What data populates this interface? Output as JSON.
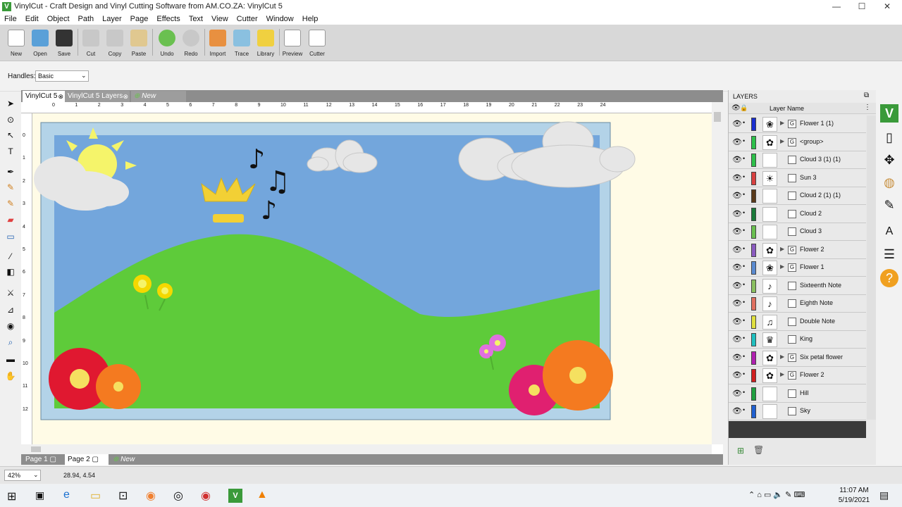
{
  "window": {
    "title": "VinylCut - Craft Design and Vinyl Cutting Software from AM.CO.ZA: VinylCut 5",
    "min": "—",
    "max": "☐",
    "close": "✕"
  },
  "menu": [
    "File",
    "Edit",
    "Object",
    "Path",
    "Layer",
    "Page",
    "Effects",
    "Text",
    "View",
    "Cutter",
    "Window",
    "Help"
  ],
  "toolbar": [
    "New",
    "Open",
    "Save",
    "Cut",
    "Copy",
    "Paste",
    "Undo",
    "Redo",
    "Import",
    "Trace",
    "Library",
    "Preview",
    "Cutter"
  ],
  "props": {
    "handles_label": "Handles:",
    "handles_value": "Basic"
  },
  "doctabs": [
    "VinylCut 5",
    "VinylCut 5 Layers",
    "New Project..."
  ],
  "ruler": [
    "0",
    "1",
    "2",
    "3",
    "4",
    "5",
    "6",
    "7",
    "8",
    "9",
    "10",
    "11",
    "12",
    "13",
    "14",
    "15",
    "16",
    "17",
    "18",
    "19",
    "20",
    "21",
    "22",
    "23",
    "24"
  ],
  "vruler": [
    "0",
    "1",
    "2",
    "3",
    "4",
    "5",
    "6",
    "7",
    "8",
    "9",
    "10",
    "11",
    "12"
  ],
  "pagetabs": [
    "Page 1",
    "Page 2",
    "New Page..."
  ],
  "status": {
    "zoom": "42%",
    "coords": "28.94, 4.54"
  },
  "layers": {
    "title": "LAYERS",
    "col": "Layer Name",
    "rows": [
      {
        "name": "Flower 1 (1)",
        "color": "#1a2fd0",
        "icon": "❀",
        "group": true
      },
      {
        "name": "<group>",
        "color": "#2ec04a",
        "icon": "✿",
        "group": true
      },
      {
        "name": "Cloud 3 (1) (1)",
        "color": "#2ec04a",
        "icon": "",
        "group": false
      },
      {
        "name": "Sun 3",
        "color": "#d84040",
        "icon": "☀",
        "group": false
      },
      {
        "name": "Cloud 2 (1) (1)",
        "color": "#5a3a1a",
        "icon": "",
        "group": false
      },
      {
        "name": "Cloud 2",
        "color": "#1a7a3a",
        "icon": "",
        "group": false
      },
      {
        "name": "Cloud 3",
        "color": "#6ac050",
        "icon": "",
        "group": false
      },
      {
        "name": "Flower 2",
        "color": "#8a5ac0",
        "icon": "✿",
        "group": true
      },
      {
        "name": "Flower 1",
        "color": "#5a8ad0",
        "icon": "❀",
        "group": true
      },
      {
        "name": "Sixteenth Note",
        "color": "#8ac060",
        "icon": "♪",
        "group": false
      },
      {
        "name": "Eighth Note",
        "color": "#e07060",
        "icon": "♪",
        "group": false
      },
      {
        "name": "Double Note",
        "color": "#e0e040",
        "icon": "♫",
        "group": false
      },
      {
        "name": "King",
        "color": "#20c0c0",
        "icon": "♛",
        "group": false
      },
      {
        "name": "Six petal flower",
        "color": "#b020b0",
        "icon": "✿",
        "group": true
      },
      {
        "name": "Flower 2",
        "color": "#d02020",
        "icon": "✿",
        "group": true
      },
      {
        "name": "Hill",
        "color": "#20a040",
        "icon": "",
        "group": false
      },
      {
        "name": "Sky",
        "color": "#2060d0",
        "icon": "",
        "group": false
      }
    ]
  },
  "taskbar": {
    "time": "11:07 AM",
    "date": "5/19/2021"
  }
}
